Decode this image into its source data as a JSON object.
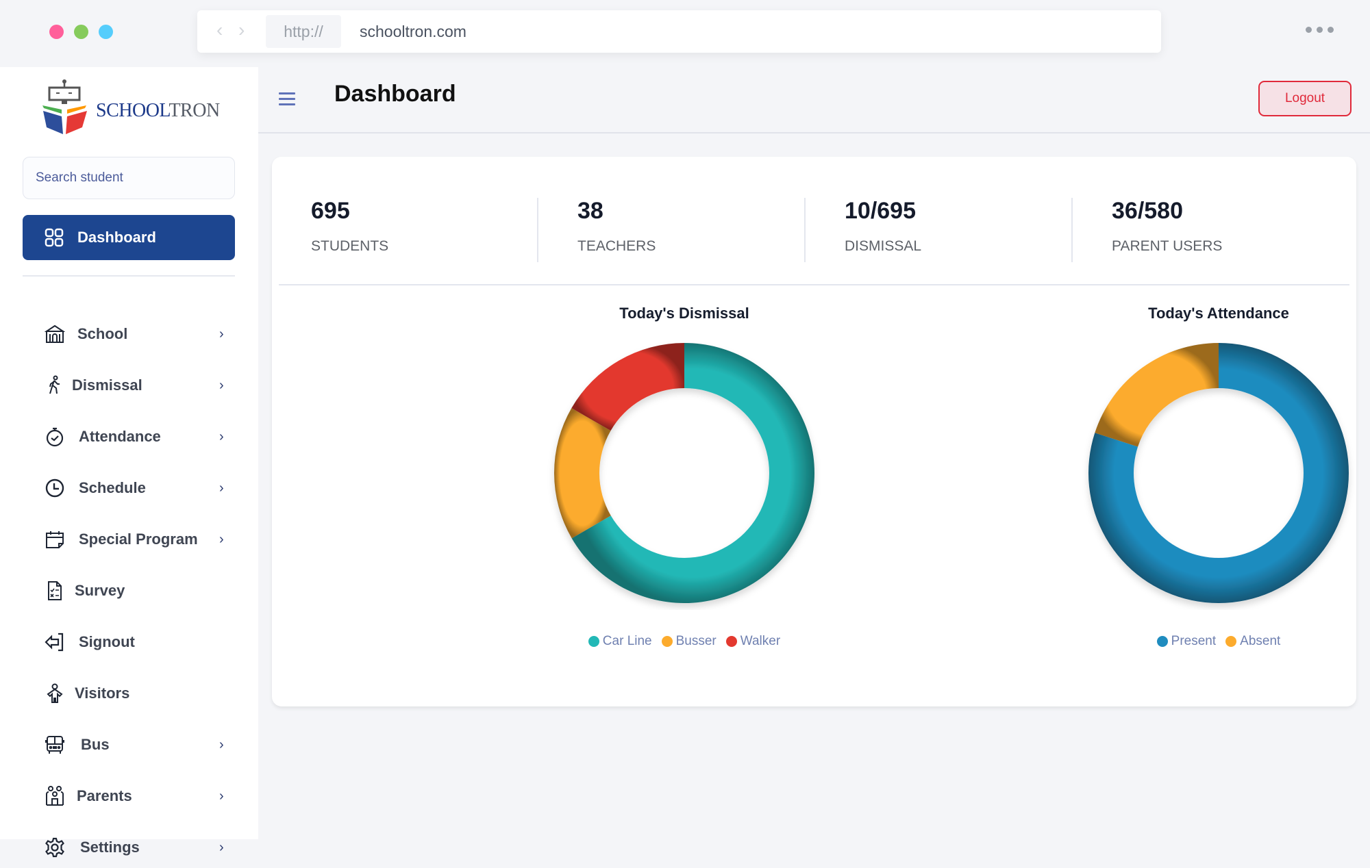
{
  "browser": {
    "protocol": "http://",
    "url": "schooltron.com",
    "traffic_lights": [
      "#ff5f9a",
      "#86cb5c",
      "#55cdfc"
    ]
  },
  "brand": {
    "name_part1": "SCHOOL",
    "name_part2": "TRON",
    "color_primary": "#1d3a8a",
    "color_secondary": "#555b66"
  },
  "sidebar": {
    "search_placeholder": "Search student",
    "active_item": {
      "label": "Dashboard",
      "icon": "grid-icon"
    },
    "items": [
      {
        "label": "School",
        "icon": "school-building-icon",
        "has_submenu": true
      },
      {
        "label": "Dismissal",
        "icon": "walking-person-icon",
        "has_submenu": true
      },
      {
        "label": "Attendance",
        "icon": "stopwatch-check-icon",
        "has_submenu": true
      },
      {
        "label": "Schedule",
        "icon": "clock-icon",
        "has_submenu": true
      },
      {
        "label": "Special Program",
        "icon": "calendar-icon",
        "has_submenu": true
      },
      {
        "label": "Survey",
        "icon": "checklist-document-icon",
        "has_submenu": false
      },
      {
        "label": "Signout",
        "icon": "signout-arrow-icon",
        "has_submenu": false
      },
      {
        "label": "Visitors",
        "icon": "visitor-person-icon",
        "has_submenu": false
      },
      {
        "label": "Bus",
        "icon": "bus-icon",
        "has_submenu": true
      },
      {
        "label": "Parents",
        "icon": "parents-icon",
        "has_submenu": true
      },
      {
        "label": "Settings",
        "icon": "gear-icon",
        "has_submenu": true
      }
    ],
    "chevron": "›"
  },
  "header": {
    "title": "Dashboard",
    "logout_label": "Logout"
  },
  "stats": [
    {
      "value": "695",
      "label": "STUDENTS"
    },
    {
      "value": "38",
      "label": "TEACHERS"
    },
    {
      "value": "10/695",
      "label": "DISMISSAL"
    },
    {
      "value": "36/580",
      "label": "PARENT USERS"
    }
  ],
  "chart_data": [
    {
      "type": "pie",
      "subtype": "donut",
      "title": "Today's Dismissal",
      "categories": [
        "Car Line",
        "Busser",
        "Walker"
      ],
      "values": [
        66.7,
        16.7,
        16.7
      ],
      "value_unit": "percent (estimated from slice angles)",
      "colors": [
        "#22b8b6",
        "#fcab2d",
        "#e3392f"
      ],
      "legend": "bottom"
    },
    {
      "type": "pie",
      "subtype": "donut",
      "title": "Today's Attendance",
      "categories": [
        "Present",
        "Absent"
      ],
      "values": [
        80,
        20
      ],
      "value_unit": "percent (estimated from slice angles)",
      "colors": [
        "#1f8cbf",
        "#fcab2d"
      ],
      "legend": "bottom"
    }
  ]
}
